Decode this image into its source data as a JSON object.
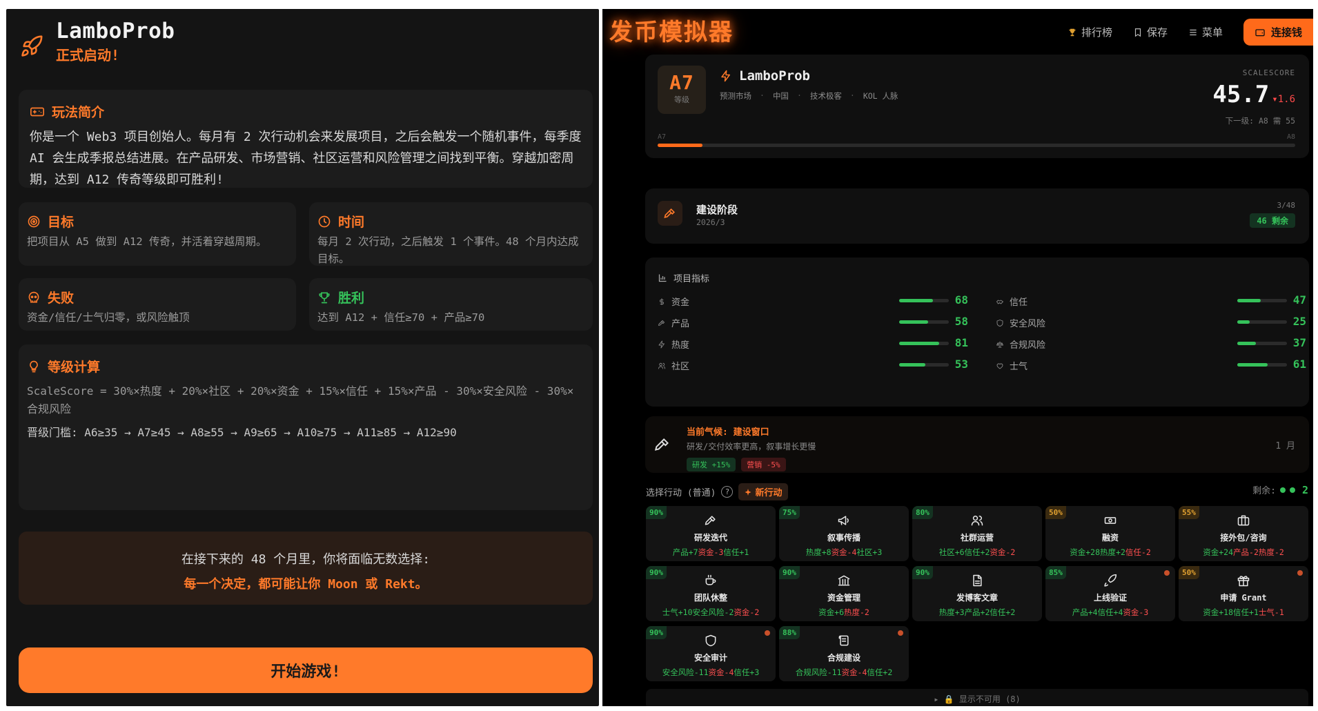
{
  "left": {
    "brand": {
      "title": "LamboProb",
      "subtitle": "正式启动!"
    },
    "intro": {
      "heading": "玩法简介",
      "text": "你是一个 Web3 项目创始人。每月有 2 次行动机会来发展项目，之后会触发一个随机事件，每季度 AI 会生成季报总结进展。在产品研发、市场营销、社区运营和风险管理之间找到平衡。穿越加密周期，达到 A12 传奇等级即可胜利!"
    },
    "goal": {
      "heading": "目标",
      "text": "把项目从 A5 做到 A12 传奇，并活着穿越周期。"
    },
    "time": {
      "heading": "时间",
      "text": "每月 2 次行动，之后触发 1 个事件。48 个月内达成目标。"
    },
    "fail": {
      "heading": "失败",
      "text": "资金/信任/士气归零，或风险触顶"
    },
    "win": {
      "heading": "胜利",
      "text": "达到 A12 + 信任≥70 + 产品≥70"
    },
    "level": {
      "heading": "等级计算",
      "formula": "ScaleScore = 30%×热度 + 20%×社区 + 20%×资金 + 15%×信任 + 15%×产品 - 30%×安全风险 - 30%×合规风险",
      "thresholds": "晋级门槛: A6≥35 → A7≥45 → A8≥55 → A9≥65 → A10≥75 → A11≥85 → A12≥90"
    },
    "warning": {
      "line1": "在接下来的 48 个月里，你将面临无数选择:",
      "line2": "每一个决定，都可能让你 Moon 或 Rekt。"
    },
    "start_button": "开始游戏!"
  },
  "right": {
    "title": "发币模拟器",
    "nav": {
      "leaderboard": "排行榜",
      "save": "保存",
      "menu": "菜单",
      "connect": "连接钱"
    },
    "project": {
      "level": "A7",
      "level_label": "等级",
      "name": "LamboProb",
      "tags": [
        "预测市场",
        "中国",
        "技术极客",
        "KOL 人脉"
      ],
      "score_label": "SCALESCORE",
      "score": "45.7",
      "score_delta": "▾1.6",
      "next_level": "下一级: A8 需 55",
      "bar_left": "A7",
      "bar_right": "A8",
      "progress": 0.07
    },
    "stage": {
      "title": "建设阶段",
      "date": "2026/3",
      "count": "3/48",
      "remaining": "46 剩余"
    },
    "metrics": {
      "heading": "项目指标",
      "left": [
        {
          "label": "资金",
          "icon": "dollar-icon",
          "value": 68
        },
        {
          "label": "产品",
          "icon": "hammer-icon",
          "value": 58
        },
        {
          "label": "热度",
          "icon": "bolt-icon",
          "value": 81
        },
        {
          "label": "社区",
          "icon": "users-icon",
          "value": 53
        }
      ],
      "right": [
        {
          "label": "信任",
          "icon": "handshake-icon",
          "value": 47
        },
        {
          "label": "安全风险",
          "icon": "shield-icon",
          "value": 25
        },
        {
          "label": "合规风险",
          "icon": "scale-icon",
          "value": 37
        },
        {
          "label": "士气",
          "icon": "heart-icon",
          "value": 61
        }
      ]
    },
    "weather": {
      "title": "当前气候: 建设窗口",
      "desc": "研发/交付效率更高，叙事增长更慢",
      "chip_good": "研发 +15%",
      "chip_bad": "营销 -5%",
      "month": "1 月"
    },
    "actions_head": {
      "label": "选择行动 (普通)",
      "qmark": "?",
      "new_action": "新行动",
      "remaining": "剩余:",
      "count": "2"
    },
    "actions": [
      {
        "pct": "90%",
        "tone": "g",
        "name": "研发迭代",
        "icon": "hammer-icon",
        "dot": false,
        "effects": [
          [
            "产品+7",
            "g"
          ],
          [
            "资金-3",
            "r"
          ],
          [
            "信任+1",
            "g"
          ]
        ]
      },
      {
        "pct": "75%",
        "tone": "g",
        "name": "叙事传播",
        "icon": "megaphone-icon",
        "dot": false,
        "effects": [
          [
            "热度+8",
            "g"
          ],
          [
            "资金-4",
            "r"
          ],
          [
            "社区+3",
            "g"
          ]
        ]
      },
      {
        "pct": "80%",
        "tone": "g",
        "name": "社群运营",
        "icon": "users-icon",
        "dot": false,
        "effects": [
          [
            "社区+6",
            "g"
          ],
          [
            "信任+2",
            "g"
          ],
          [
            "资金-2",
            "r"
          ]
        ]
      },
      {
        "pct": "50%",
        "tone": "y",
        "name": "融资",
        "icon": "banknote-icon",
        "dot": false,
        "effects": [
          [
            "资金+28",
            "g"
          ],
          [
            "热度+2",
            "g"
          ],
          [
            "信任-2",
            "r"
          ]
        ]
      },
      {
        "pct": "55%",
        "tone": "y",
        "name": "接外包/咨询",
        "icon": "briefcase-icon",
        "dot": false,
        "effects": [
          [
            "资金+24",
            "g"
          ],
          [
            "产品-2",
            "r"
          ],
          [
            "热度-2",
            "r"
          ]
        ]
      },
      {
        "pct": "90%",
        "tone": "g",
        "name": "团队休整",
        "icon": "coffee-icon",
        "dot": false,
        "effects": [
          [
            "士气+10",
            "g"
          ],
          [
            "安全风险-2",
            "g"
          ],
          [
            "资金-2",
            "r"
          ]
        ]
      },
      {
        "pct": "90%",
        "tone": "g",
        "name": "资金管理",
        "icon": "bank-icon",
        "dot": false,
        "effects": [
          [
            "资金+6",
            "g"
          ],
          [
            "热度-2",
            "r"
          ]
        ]
      },
      {
        "pct": "90%",
        "tone": "g",
        "name": "发博客文章",
        "icon": "document-icon",
        "dot": false,
        "effects": [
          [
            "热度+3",
            "g"
          ],
          [
            "产品+2",
            "g"
          ],
          [
            "信任+2",
            "g"
          ]
        ]
      },
      {
        "pct": "85%",
        "tone": "g",
        "name": "上线验证",
        "icon": "rocket-icon",
        "dot": true,
        "effects": [
          [
            "产品+4",
            "g"
          ],
          [
            "信任+4",
            "g"
          ],
          [
            "资金-3",
            "r"
          ]
        ]
      },
      {
        "pct": "50%",
        "tone": "y",
        "name": "申请 Grant",
        "icon": "gift-icon",
        "dot": true,
        "effects": [
          [
            "资金+18",
            "g"
          ],
          [
            "信任+1",
            "g"
          ],
          [
            "士气-1",
            "r"
          ]
        ]
      },
      {
        "pct": "90%",
        "tone": "g",
        "name": "安全审计",
        "icon": "shield-icon",
        "dot": true,
        "effects": [
          [
            "安全风险-11",
            "g"
          ],
          [
            "资金-4",
            "r"
          ],
          [
            "信任+3",
            "g"
          ]
        ]
      },
      {
        "pct": "88%",
        "tone": "g",
        "name": "合规建设",
        "icon": "scroll-icon",
        "dot": true,
        "effects": [
          [
            "合规风险-11",
            "g"
          ],
          [
            "资金-4",
            "r"
          ],
          [
            "信任+2",
            "g"
          ]
        ]
      }
    ],
    "show_unavailable": "▸ 🔒 显示不可用 (8)",
    "colors": {
      "accent": "#ff7a2a",
      "good": "#35c25a",
      "bad": "#ff5050"
    }
  }
}
